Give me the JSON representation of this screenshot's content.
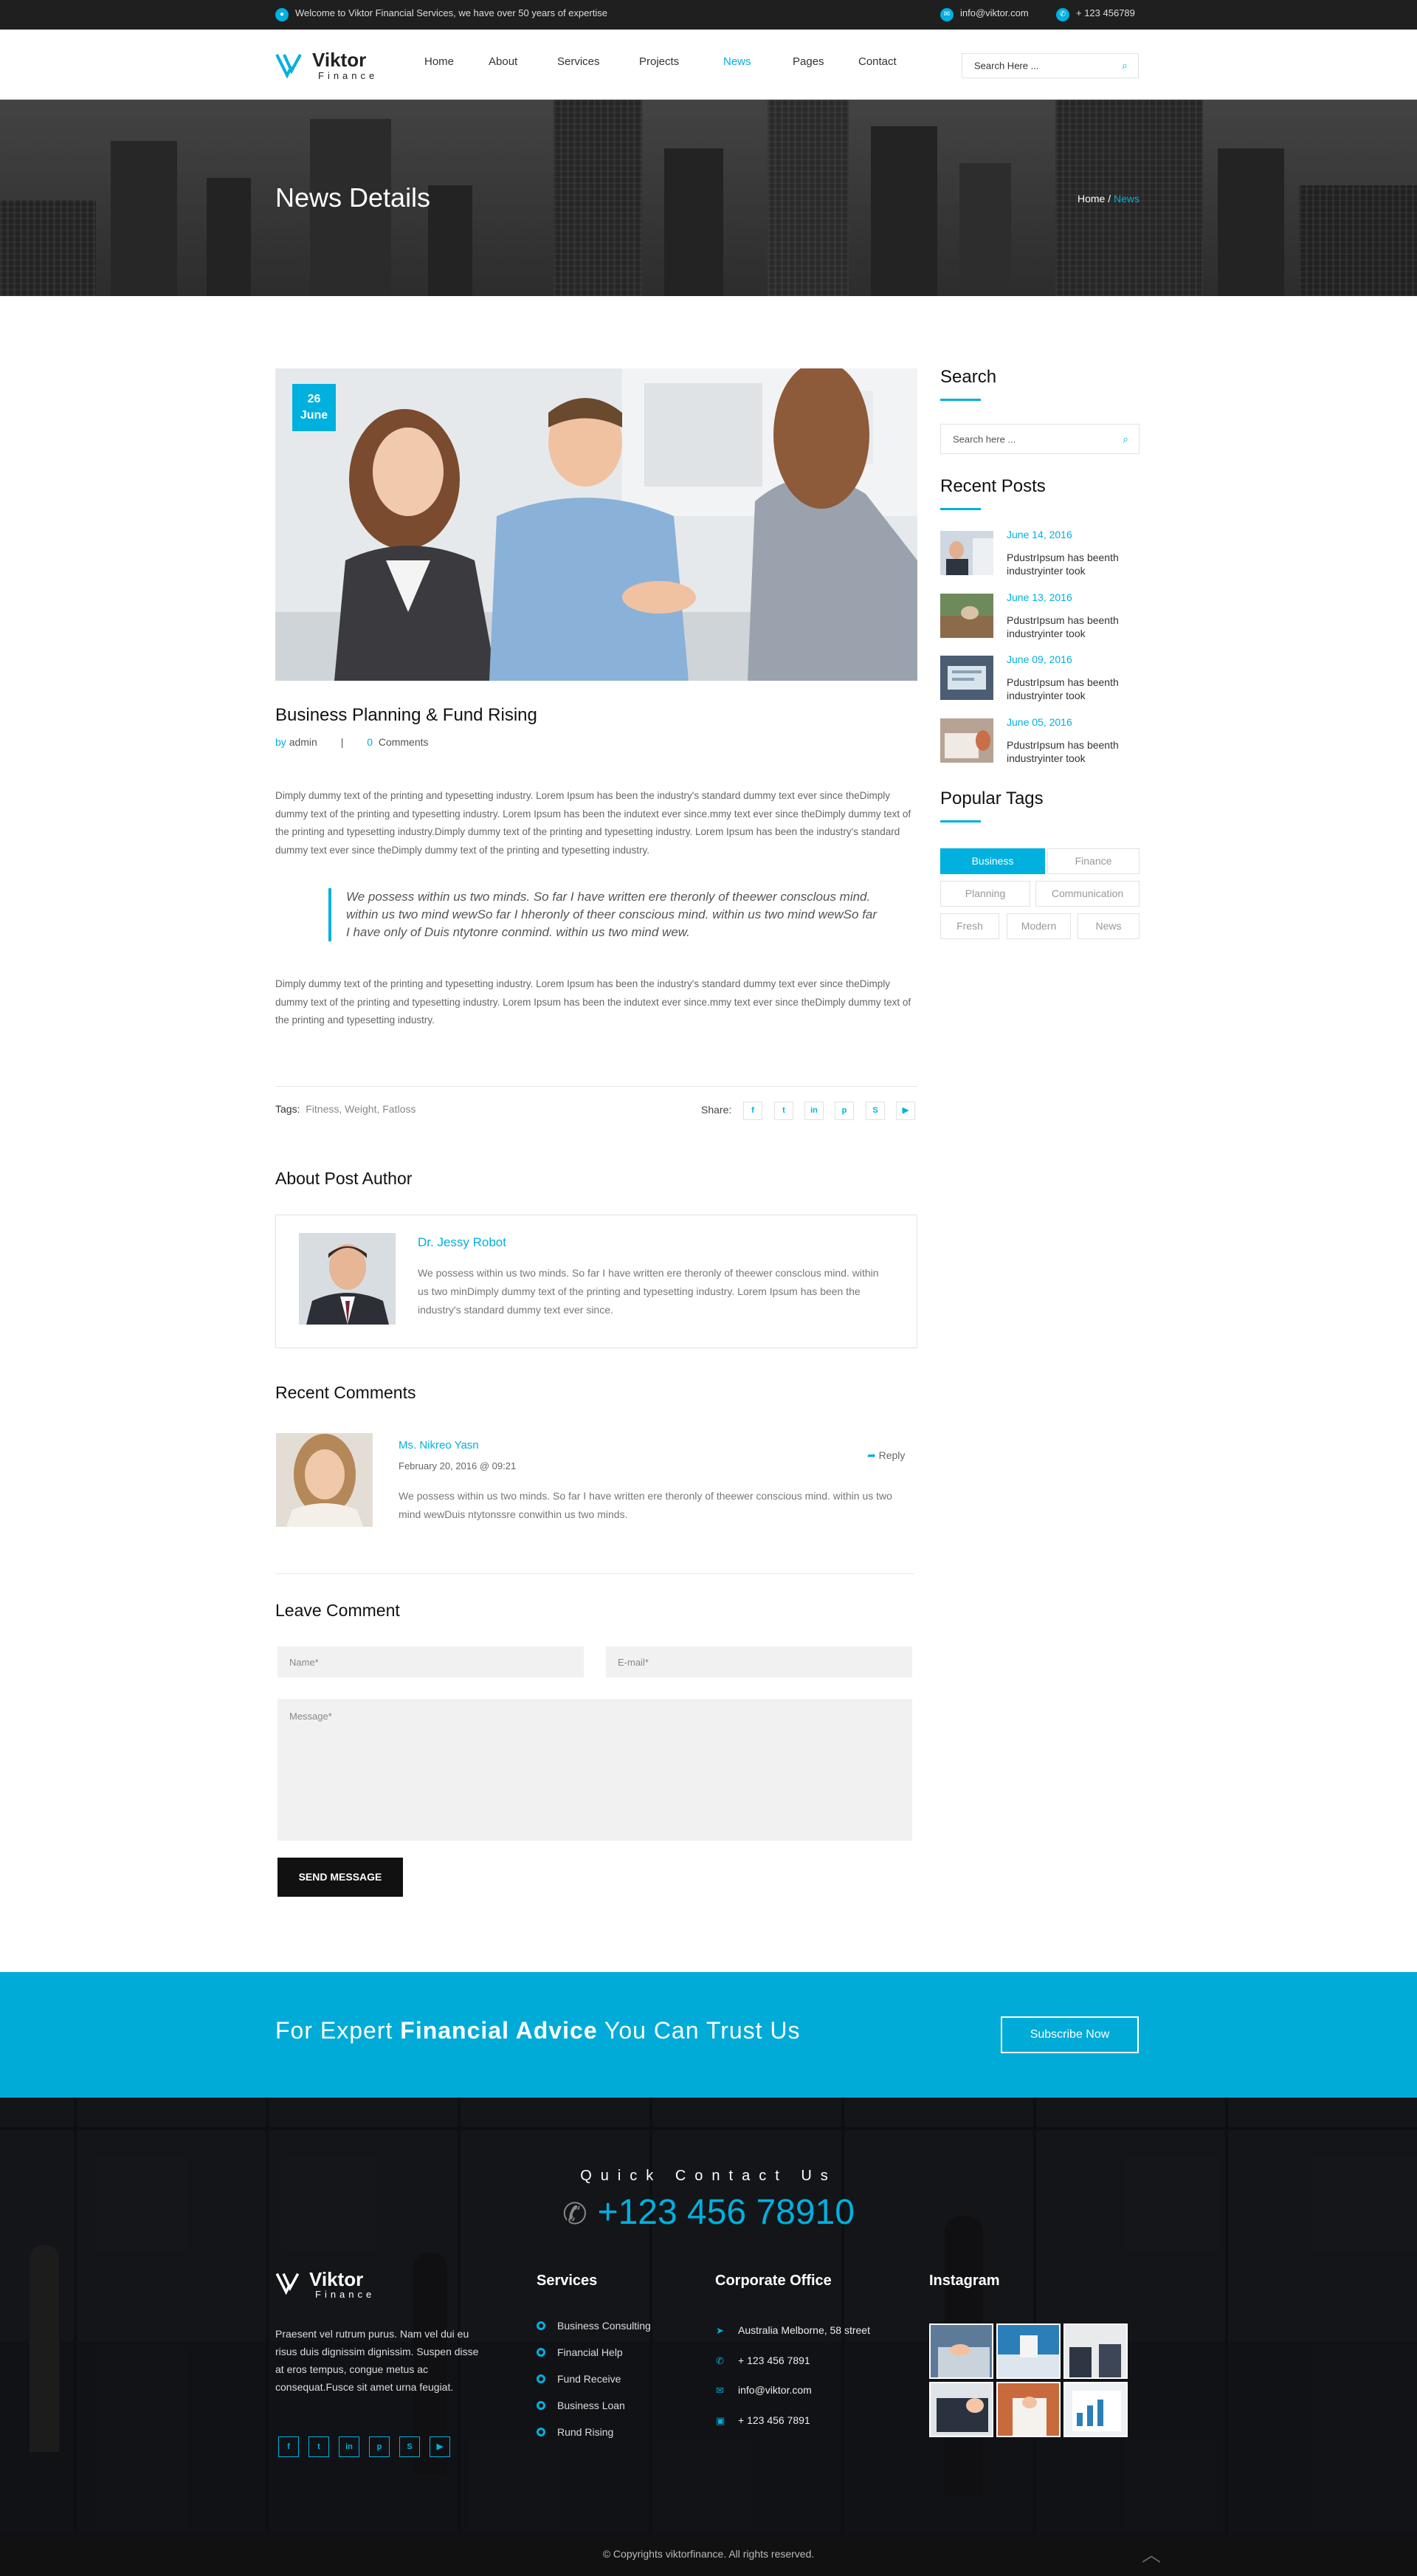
{
  "topbar": {
    "welcome": "Welcome to Viktor  Financial Services, we have over 50 years of expertise",
    "email": "info@viktor.com",
    "phone": "+ 123 456789"
  },
  "header": {
    "logo_name": "Viktor",
    "logo_sub": "Finance",
    "nav": [
      "Home",
      "About",
      "Services",
      "Projects",
      "News",
      "Pages",
      "Contact"
    ],
    "active_nav": "News",
    "search_placeholder": "Search Here ..."
  },
  "banner": {
    "title": "News Details",
    "breadcrumb_home": "Home",
    "breadcrumb_sep": " / ",
    "breadcrumb_current": "News"
  },
  "post": {
    "date_day": "26",
    "date_month": "June",
    "title": "Business Planning & Fund Rising",
    "by": "by",
    "author": "admin",
    "sep": "|",
    "comment_count": "0",
    "comments_label": "Comments",
    "para1": "Dimply dummy text of the printing and typesetting industry. Lorem Ipsum has been the industry's standard dummy text ever since theDimply dummy text of the printing and typesetting industry. Lorem Ipsum has been the indutext ever since.mmy text ever since theDimply dummy text of the printing and typesetting industry.Dimply dummy text of the printing and typesetting industry. Lorem Ipsum has been the industry's standard dummy text ever since theDimply dummy text of the printing and typesetting industry.",
    "quote": "We possess within us two minds. So far I have written ere  theronly of theewer consclous mind. within us two mind wewSo far I hheronly of theer conscious mind. within us two mind wewSo far I have only of Duis ntytonre conmind. within us two mind wew.",
    "para2": "Dimply dummy text of the printing and typesetting industry. Lorem Ipsum has been the industry's standard dummy text ever since theDimply dummy text of the printing and typesetting industry. Lorem Ipsum has been the indutext ever since.mmy text ever since theDimply dummy text of the printing and typesetting industry.",
    "tags_label": "Tags:",
    "tags_value": "Fitness, Weight, Fatloss",
    "share_label": "Share:",
    "share_icons": [
      "facebook-icon",
      "twitter-icon",
      "linkedin-icon",
      "pinterest-icon",
      "skype-icon",
      "youtube-icon"
    ]
  },
  "author_section": {
    "title": "About Post Author",
    "name": "Dr. Jessy Robot",
    "text": "We possess within us two minds. So far I have written ere  theronly of theewer consclous mind. within us two minDimply dummy text of the printing and typesetting industry. Lorem Ipsum has been the industry's standard dummy text ever since."
  },
  "comments_section": {
    "title": "Recent Comments",
    "name": "Ms. Nikreo Yasn",
    "date": "February 20, 2016 @ 09:21",
    "reply": "Reply",
    "text": "We possess within us two minds. So far I have written ere  theronly of theewer conscious mind. within us two mind wewDuis ntytonssre conwithin us two minds."
  },
  "leave_comment": {
    "title": "Leave Comment",
    "name_placeholder": "Name*",
    "email_placeholder": "E-mail*",
    "message_placeholder": "Message*",
    "send": "SEND MESSAGE"
  },
  "sidebar": {
    "search_title": "Search",
    "search_placeholder": "Search here ...",
    "recent_title": "Recent Posts",
    "recent_posts": [
      {
        "date": "June 14, 2016",
        "line1": "PdustrIpsum has beenth",
        "line2": "industryinter took"
      },
      {
        "date": "June 13, 2016",
        "line1": "PdustrIpsum has beenth",
        "line2": "industryinter took"
      },
      {
        "date": "June 09, 2016",
        "line1": "PdustrIpsum has beenth",
        "line2": "industryinter took"
      },
      {
        "date": "June 05, 2016",
        "line1": "PdustrIpsum has beenth",
        "line2": "industryinter took"
      }
    ],
    "tags_title": "Popular Tags",
    "tags": [
      "Business",
      "Finance",
      "Planning",
      "Communication",
      "Fresh",
      "Modern",
      "News"
    ]
  },
  "cta": {
    "pre": "For Expert ",
    "bold": "Financial Advice",
    "post": " You Can Trust Us",
    "button": "Subscribe Now"
  },
  "footer": {
    "quick_contact": "Quick Contact Us",
    "phone": "+123 456 78910",
    "about_text": "Praesent vel rutrum purus. Nam vel dui eu risus duis dignissim dignissim. Suspen disse at eros tempus, congue metus ac consequat.Fusce sit amet urna feugiat.",
    "services_title": "Services",
    "services": [
      "Business Consulting",
      "Financial Help",
      "Fund Receive",
      "Business Loan",
      "Rund Rising"
    ],
    "office_title": "Corporate Office",
    "office": [
      "Australia Melborne, 58 street",
      "+ 123 456 7891",
      "info@viktor.com",
      "+ 123 456 7891"
    ],
    "instagram_title": "Instagram",
    "copyright": "© Copyrights viktorfinance. All rights reserved."
  },
  "colors": {
    "accent": "#00b0de",
    "cta": "#00abd8",
    "dark": "#1f1f1f"
  }
}
